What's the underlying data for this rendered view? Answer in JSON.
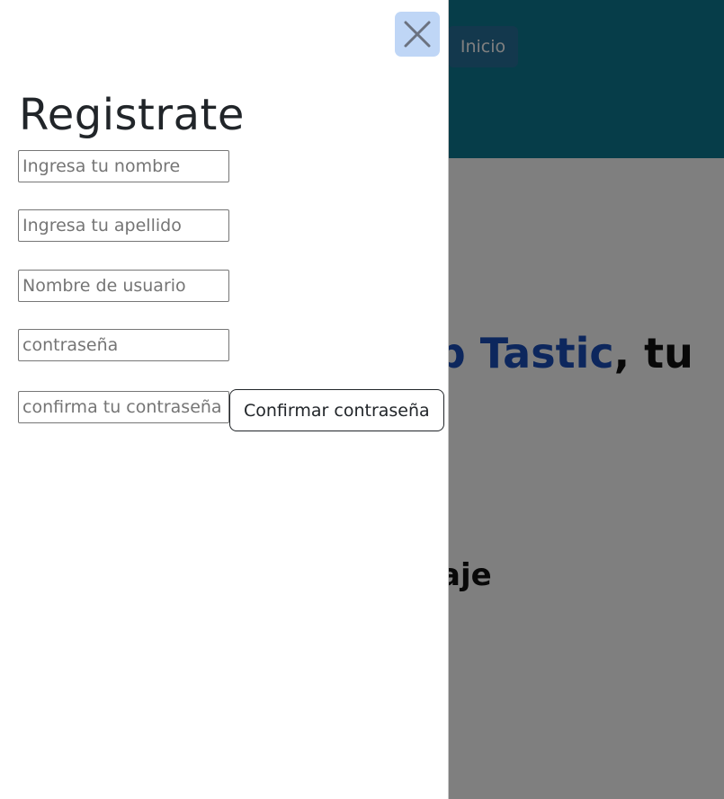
{
  "background": {
    "nav": {
      "inicio_label": "Inicio"
    },
    "hero": {
      "brand": "Trip Tastic",
      "title_rest": ", tu",
      "subtitle": "o viaje"
    }
  },
  "colors": {
    "header_bg": "#0c7b93",
    "brand": "#1a4fba",
    "close_bg": "#bfd6f6"
  },
  "panel": {
    "title": "Registrate",
    "close_icon": "close-icon",
    "fields": {
      "nombre_placeholder": "Ingresa tu nombre",
      "apellido_placeholder": "Ingresa tu apellido",
      "usuario_placeholder": "Nombre de usuario",
      "password_placeholder": "contraseña",
      "confirm_password_placeholder": "confirma tu contraseña"
    },
    "confirm_button_label": "Confirmar contraseña"
  }
}
